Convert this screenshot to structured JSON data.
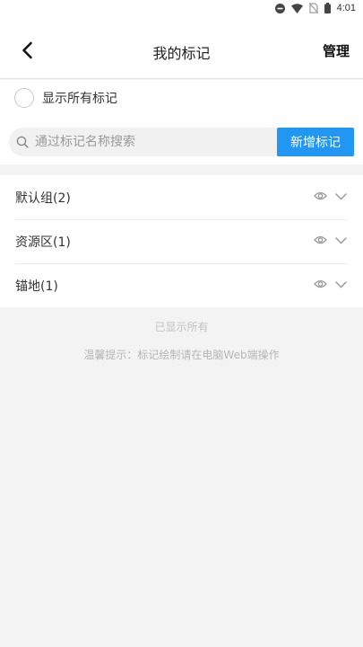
{
  "status_bar": {
    "time": "4:01",
    "icons": [
      "do-not-disturb-icon",
      "wifi-icon",
      "no-sim-icon",
      "battery-icon"
    ]
  },
  "nav": {
    "title": "我的标记",
    "manage_label": "管理",
    "back_icon": "chevron-left-icon"
  },
  "show_all": {
    "label": "显示所有标记",
    "checked": false
  },
  "search": {
    "placeholder": "通过标记名称搜索",
    "value": "",
    "add_button_label": "新增标记"
  },
  "groups": [
    {
      "label": "默认组(2)"
    },
    {
      "label": "资源区(1)"
    },
    {
      "label": "锚地(1)"
    }
  ],
  "hints": {
    "shown_all": "已显示所有",
    "tip": "温馨提示：标记绘制请在电脑Web端操作"
  },
  "colors": {
    "accent": "#2196f3",
    "page_bg": "#f3f3f3"
  }
}
